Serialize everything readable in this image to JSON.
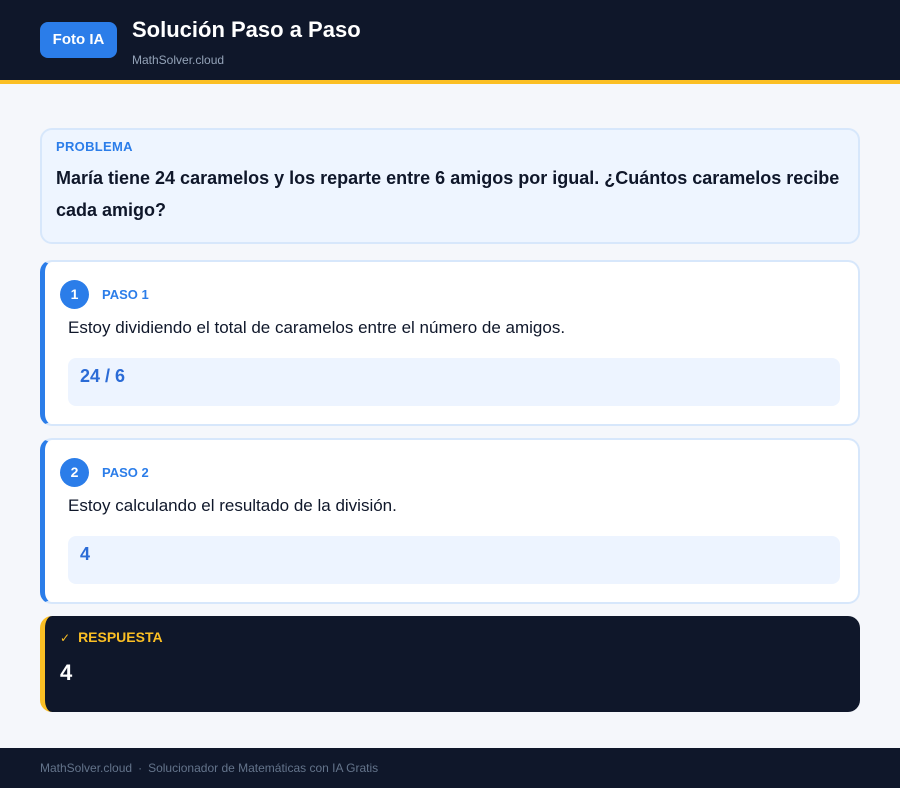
{
  "header": {
    "badge_label": "Foto IA",
    "title": "Solución Paso a Paso",
    "subtitle": "MathSolver.cloud"
  },
  "problem": {
    "label": "PROBLEMA",
    "text": "María tiene 24 caramelos y los reparte entre 6 amigos por igual. ¿Cuántos caramelos recibe cada amigo?"
  },
  "steps": [
    {
      "number": "1",
      "label": "PASO 1",
      "text": "Estoy dividiendo el total de caramelos entre el número de amigos.",
      "math": "24 / 6"
    },
    {
      "number": "2",
      "label": "PASO 2",
      "text": "Estoy calculando el resultado de la división.",
      "math": "4"
    }
  ],
  "answer": {
    "icon": "check-icon",
    "label": "RESPUESTA",
    "value": "4"
  },
  "footer": {
    "site": "MathSolver.cloud",
    "separator": "·",
    "tagline": "Solucionador de Matemáticas con IA Gratis"
  },
  "colors": {
    "header_bg": "#0f172a",
    "accent": "#2b7de9",
    "highlight": "#fbbf24",
    "page_bg": "#f5f7fb"
  }
}
